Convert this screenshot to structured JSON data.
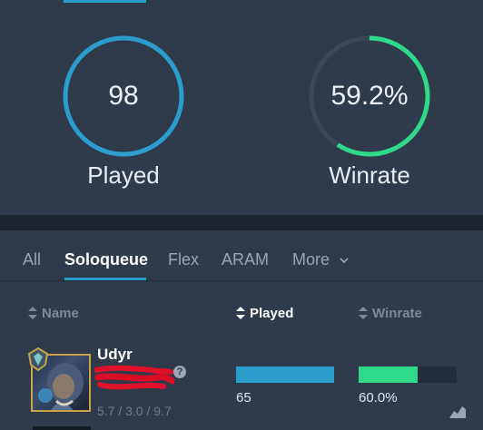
{
  "stats": {
    "played": {
      "value": "98",
      "label": "Played",
      "fraction": 1.0
    },
    "winrate": {
      "value": "59.2%",
      "label": "Winrate",
      "fraction": 0.592
    }
  },
  "tabs": [
    {
      "label": "All"
    },
    {
      "label": "Soloqueue"
    },
    {
      "label": "Flex"
    },
    {
      "label": "ARAM"
    },
    {
      "label": "More"
    }
  ],
  "active_tab": "Soloqueue",
  "columns": {
    "name": "Name",
    "played": "Played",
    "winrate": "Winrate"
  },
  "row": {
    "champion": "Udyr",
    "kda": "5.7 / 3.0 / 9.7",
    "played": "65",
    "played_fraction": 1.0,
    "winrate": "60.0%",
    "winrate_fraction": 0.6
  },
  "colors": {
    "accent_blue": "#2a9dcc",
    "accent_green": "#2fd98a",
    "ring_track": "#3c4757"
  }
}
